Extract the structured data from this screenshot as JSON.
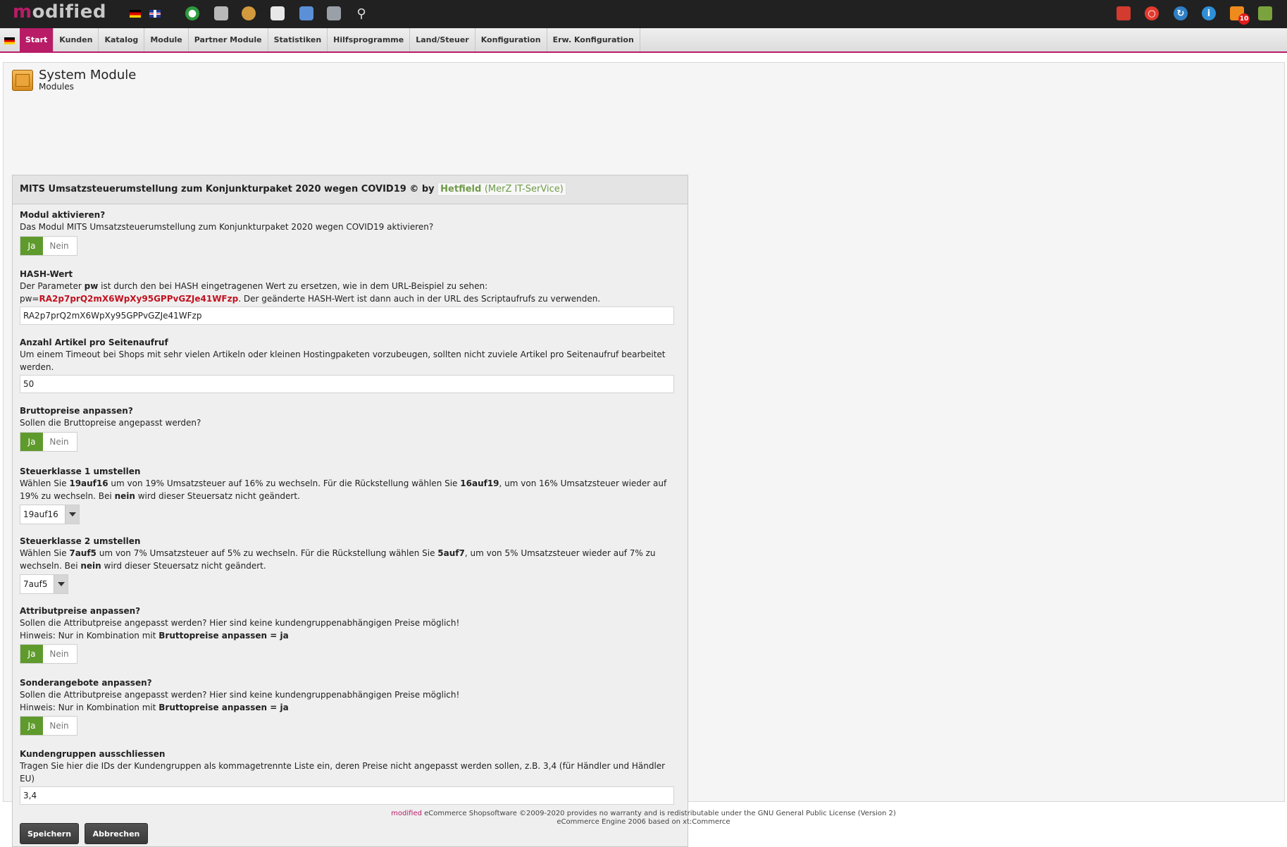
{
  "app": {
    "logo_text_m": "m",
    "logo_text_rest": "odified"
  },
  "topbar": {
    "flags": [
      "de-flag",
      "en-flag"
    ],
    "left_icons": [
      "globe-icon",
      "catalog-icon",
      "customers-icon",
      "orders-icon",
      "content-icon",
      "modules-icon",
      "search-icon"
    ],
    "right_icons": [
      "calendar-icon",
      "help-icon",
      "refresh-icon",
      "info-icon",
      "rss-icon",
      "logout-icon"
    ],
    "rss_badge": "10"
  },
  "menu": {
    "items": [
      {
        "label": "Start",
        "active": true
      },
      {
        "label": "Kunden"
      },
      {
        "label": "Katalog"
      },
      {
        "label": "Module"
      },
      {
        "label": "Partner Module"
      },
      {
        "label": "Statistiken"
      },
      {
        "label": "Hilfsprogramme"
      },
      {
        "label": "Land/Steuer"
      },
      {
        "label": "Konfiguration"
      },
      {
        "label": "Erw. Konfiguration"
      }
    ]
  },
  "page": {
    "title": "System Module",
    "subtitle": "Modules"
  },
  "module": {
    "header": "MITS Umsatzsteuerumstellung zum Konjunkturpaket 2020 wegen COVID19 © by",
    "author_name": "Hetfield",
    "author_company": "(MerZ IT-SerVice)",
    "fields": {
      "activate": {
        "label": "Modul aktivieren?",
        "desc": "Das Modul MITS Umsatzsteuerumstellung zum Konjunkturpaket 2020 wegen COVID19 aktivieren?",
        "yes": "Ja",
        "no": "Nein",
        "value": "Ja"
      },
      "hash": {
        "label": "HASH-Wert",
        "desc_1a": "Der Parameter ",
        "desc_1b": "pw",
        "desc_1c": " ist durch den bei HASH eingetragenen Wert zu ersetzen, wie in dem URL-Beispiel zu sehen:",
        "desc_2a": "pw=",
        "desc_2b": "RA2p7prQ2mX6WpXy95GPPvGZJe41WFzp",
        "desc_2c": ". Der geänderte HASH-Wert ist dann auch in der URL des Scriptaufrufs zu verwenden.",
        "value": "RA2p7prQ2mX6WpXy95GPPvGZJe41WFzp"
      },
      "per_page": {
        "label": "Anzahl Artikel pro Seitenaufruf",
        "desc": "Um einem Timeout bei Shops mit sehr vielen Artikeln oder kleinen Hostingpaketen vorzubeugen, sollten nicht zuviele Artikel pro Seitenaufruf bearbeitet werden.",
        "value": "50"
      },
      "gross": {
        "label": "Bruttopreise anpassen?",
        "desc": "Sollen die Bruttopreise angepasst werden?",
        "yes": "Ja",
        "no": "Nein",
        "value": "Ja"
      },
      "tax1": {
        "label": "Steuerklasse 1 umstellen",
        "desc_a": "Wählen Sie ",
        "desc_b": "19auf16",
        "desc_c": " um von 19% Umsatzsteuer auf 16% zu wechseln. Für die Rückstellung wählen Sie ",
        "desc_d": "16auf19",
        "desc_e": ", um von 16% Umsatzsteuer wieder auf 19% zu wechseln. Bei ",
        "desc_f": "nein",
        "desc_g": " wird dieser Steuersatz nicht geändert.",
        "value": "19auf16"
      },
      "tax2": {
        "label": "Steuerklasse 2 umstellen",
        "desc_a": "Wählen Sie ",
        "desc_b": "7auf5",
        "desc_c": " um von 7% Umsatzsteuer auf 5% zu wechseln. Für die Rückstellung wählen Sie ",
        "desc_d": "5auf7",
        "desc_e": ", um von 5% Umsatzsteuer wieder auf 7% zu wechseln. Bei ",
        "desc_f": "nein",
        "desc_g": " wird dieser Steuersatz nicht geändert.",
        "value": "7auf5"
      },
      "attr": {
        "label": "Attributpreise anpassen?",
        "desc": "Sollen die Attributpreise angepasst werden? Hier sind keine kundengruppenabhängigen Preise möglich!",
        "hint_a": "Hinweis: Nur in Kombination mit ",
        "hint_b": "Bruttopreise anpassen = ja",
        "yes": "Ja",
        "no": "Nein",
        "value": "Ja"
      },
      "specials": {
        "label": "Sonderangebote anpassen?",
        "desc": "Sollen die Attributpreise angepasst werden? Hier sind keine kundengruppenabhängigen Preise möglich!",
        "hint_a": "Hinweis: Nur in Kombination mit ",
        "hint_b": "Bruttopreise anpassen = ja",
        "yes": "Ja",
        "no": "Nein",
        "value": "Ja"
      },
      "groups": {
        "label": "Kundengruppen ausschliessen",
        "desc": "Tragen Sie hier die IDs der Kundengruppen als kommagetrennte Liste ein, deren Preise nicht angepasst werden sollen, z.B. 3,4 (für Händler und Händler EU)",
        "value": "3,4"
      }
    },
    "save_label": "Speichern",
    "cancel_label": "Abbrechen"
  },
  "footer": {
    "brand": "modified",
    "line1": " eCommerce Shopsoftware ©2009-2020 provides no warranty and is redistributable under the GNU General Public License (Version 2)",
    "line2": "eCommerce Engine 2006 based on xt:Commerce"
  },
  "colors": {
    "brand": "#b81c67",
    "toggle_on": "#5f9a2c",
    "hash_red": "#c1121f",
    "topbar": "#212121"
  }
}
